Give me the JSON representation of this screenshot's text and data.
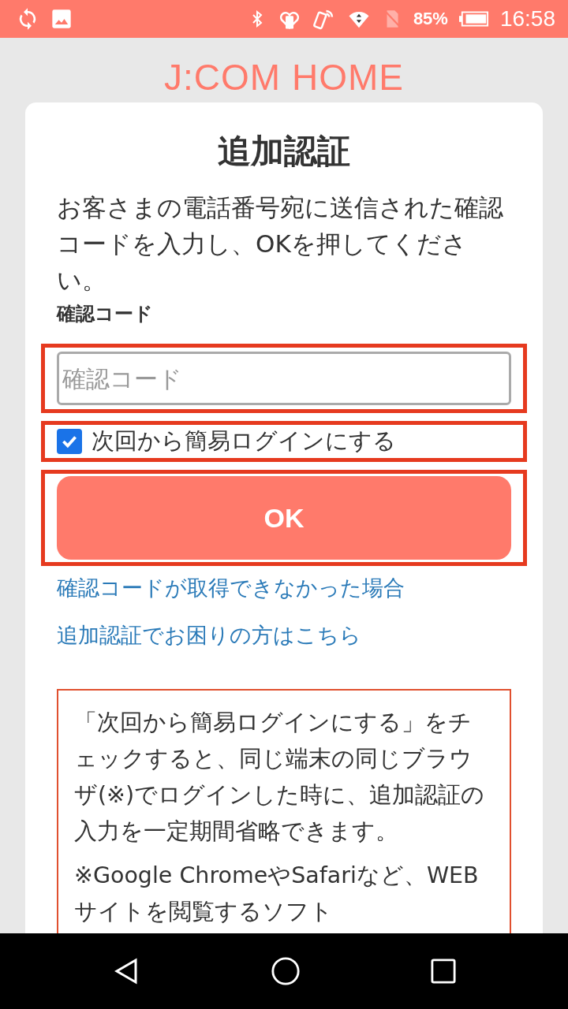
{
  "status_bar": {
    "battery": "85%",
    "time": "16:58"
  },
  "logo": "J:COM HOME",
  "title": "追加認証",
  "instruction": "お客さまの電話番号宛に送信された確認コードを入力し、OKを押してください。",
  "code_field": {
    "label": "確認コード",
    "placeholder": "確認コード",
    "highlighted": true
  },
  "remember": {
    "label": "次回から簡易ログインにする",
    "checked": true,
    "highlighted": true
  },
  "ok_button": {
    "label": "OK",
    "highlighted": true
  },
  "links": [
    "確認コードが取得できなかった場合",
    "追加認証でお困りの方はこちら"
  ],
  "notice": [
    "「次回から簡易ログインにする」をチェックすると、同じ端末の同じブラウザ(※)でログインした時に、追加認証の入力を一定期間省略できます。",
    "※Google ChromeやSafariなど、WEBサイトを閲覧するソフト"
  ]
}
